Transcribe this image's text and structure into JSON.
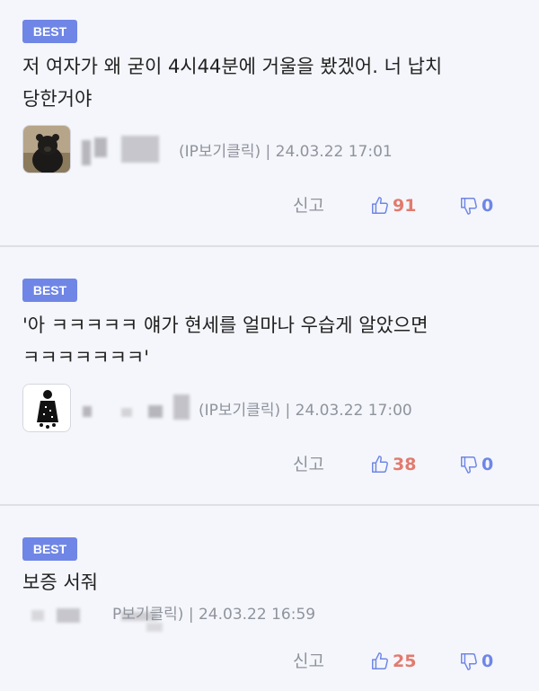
{
  "comments": [
    {
      "badge": "BEST",
      "text_line1": "저 여자가 왜 굳이 4시44분에 거울을 봤겠어. 너 납치",
      "text_line2": "당한거야",
      "avatar": "bear-avatar",
      "meta": "(IP보기클릭) | 24.03.22 17:01",
      "report_label": "신고",
      "likes": "91",
      "dislikes": "0"
    },
    {
      "badge": "BEST",
      "text_line1": "'아 ㅋㅋㅋㅋㅋ 얘가 현세를 얼마나 우습게 알았으면",
      "text_line2": "ㅋㅋㅋㅋㅋㅋㅋ'",
      "avatar": "figure-avatar",
      "meta": "(IP보기클릭) | 24.03.22 17:00",
      "report_label": "신고",
      "likes": "38",
      "dislikes": "0"
    },
    {
      "badge": "BEST",
      "text_line1": "보증 서줘",
      "meta": "P보기클릭) | 24.03.22 16:59",
      "report_label": "신고",
      "likes": "25",
      "dislikes": "0"
    }
  ],
  "icons": {
    "like": "thumbs-up-icon",
    "dislike": "thumbs-down-icon"
  },
  "colors": {
    "badge": "#6f86e6",
    "like": "#e27a6e",
    "dislike": "#6f86e6",
    "background": "#f4f6fb"
  }
}
